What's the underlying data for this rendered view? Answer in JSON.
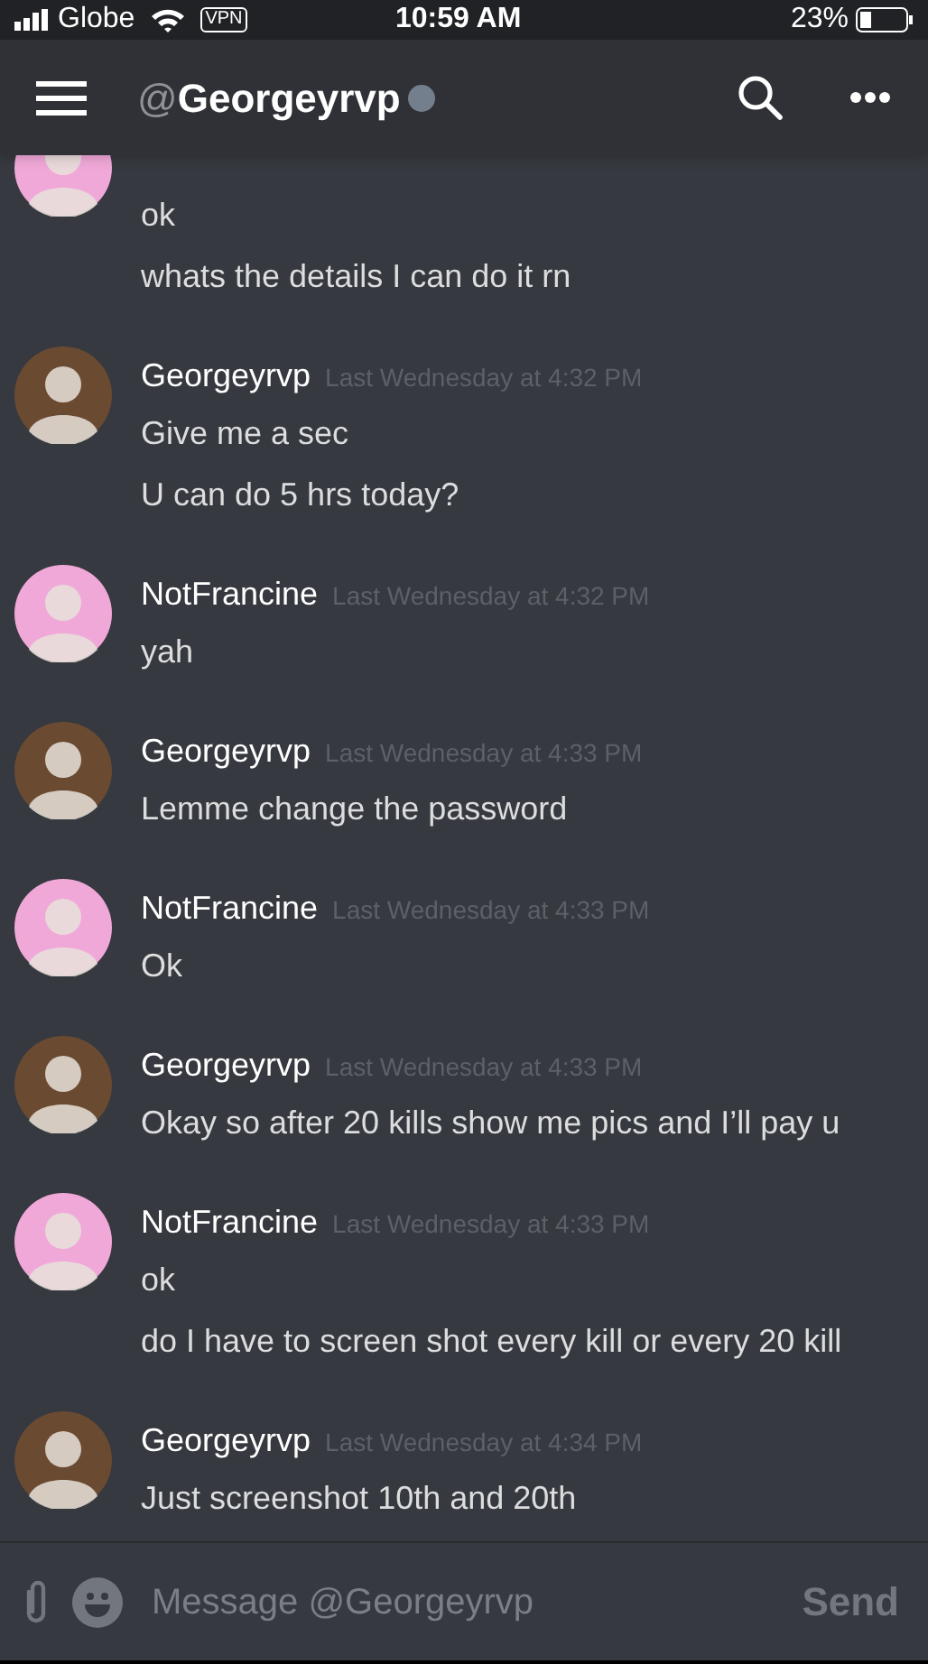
{
  "status_bar": {
    "carrier": "Globe",
    "vpn": "VPN",
    "time": "10:59 AM",
    "battery": "23%"
  },
  "header": {
    "at": "@",
    "title": "Georgeyrvp"
  },
  "messages": [
    {
      "color": "#f0a8d8",
      "lines": [
        "ok",
        "whats the details I can do it rn"
      ]
    },
    {
      "color": "#6b4a32",
      "author": "Georgeyrvp",
      "time": "Last Wednesday at 4:32 PM",
      "lines": [
        "Give me a sec",
        "U can do 5 hrs today?"
      ]
    },
    {
      "color": "#f0a8d8",
      "author": "NotFrancine",
      "time": "Last Wednesday at 4:32 PM",
      "lines": [
        "yah"
      ]
    },
    {
      "color": "#6b4a32",
      "author": "Georgeyrvp",
      "time": "Last Wednesday at 4:33 PM",
      "lines": [
        "Lemme change the password"
      ]
    },
    {
      "color": "#f0a8d8",
      "author": "NotFrancine",
      "time": "Last Wednesday at 4:33 PM",
      "lines": [
        "Ok"
      ]
    },
    {
      "color": "#6b4a32",
      "author": "Georgeyrvp",
      "time": "Last Wednesday at 4:33 PM",
      "lines": [
        "Okay so after 20 kills show me pics and I’ll pay u"
      ]
    },
    {
      "color": "#f0a8d8",
      "author": "NotFrancine",
      "time": "Last Wednesday at 4:33 PM",
      "lines": [
        "ok",
        "do I have to screen shot every kill or every 20 kill"
      ]
    },
    {
      "color": "#6b4a32",
      "author": "Georgeyrvp",
      "time": "Last Wednesday at 4:34 PM",
      "lines": [
        "Just screenshot 10th and 20th"
      ]
    }
  ],
  "composer": {
    "placeholder": "Message @Georgeyrvp",
    "send": "Send"
  }
}
